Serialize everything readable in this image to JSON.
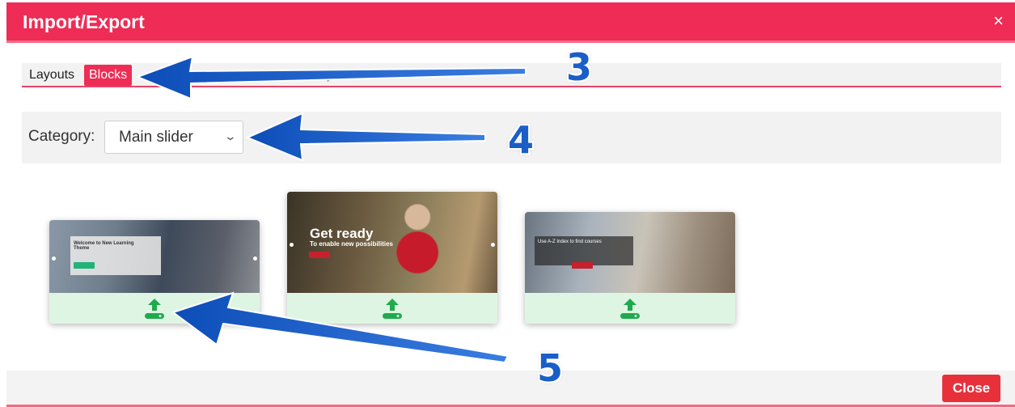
{
  "dialog": {
    "title": "Import/Export",
    "close_glyph": "×",
    "accent_color": "#ee2c55"
  },
  "tabs": [
    {
      "label": "Layouts",
      "active": false
    },
    {
      "label": "Blocks",
      "active": true
    },
    {
      "label": "Export Layout",
      "active": false,
      "obscured": true
    },
    {
      "label": "Import Layout",
      "active": false,
      "obscured": true
    }
  ],
  "visible_tab_fragments": [
    "…p",
    "ort Layout"
  ],
  "category": {
    "label": "Category:",
    "selected": "Main slider"
  },
  "blocks": [
    {
      "preview_title": "Welcome to New Learning Theme",
      "import_icon": "upload-icon"
    },
    {
      "preview_title": "Get ready",
      "preview_subtitle": "To enable new possibilities",
      "import_icon": "upload-icon"
    },
    {
      "preview_title": "Use A-Z Index to find courses",
      "import_icon": "upload-icon"
    }
  ],
  "annotations": [
    "3",
    "4",
    "5"
  ],
  "footer": {
    "close_label": "Close"
  },
  "colors": {
    "import_zone": "#dff5e3",
    "import_icon": "#1faa4d",
    "annotation_arrow": "#1a5ec8",
    "close_button": "#e8303b"
  }
}
